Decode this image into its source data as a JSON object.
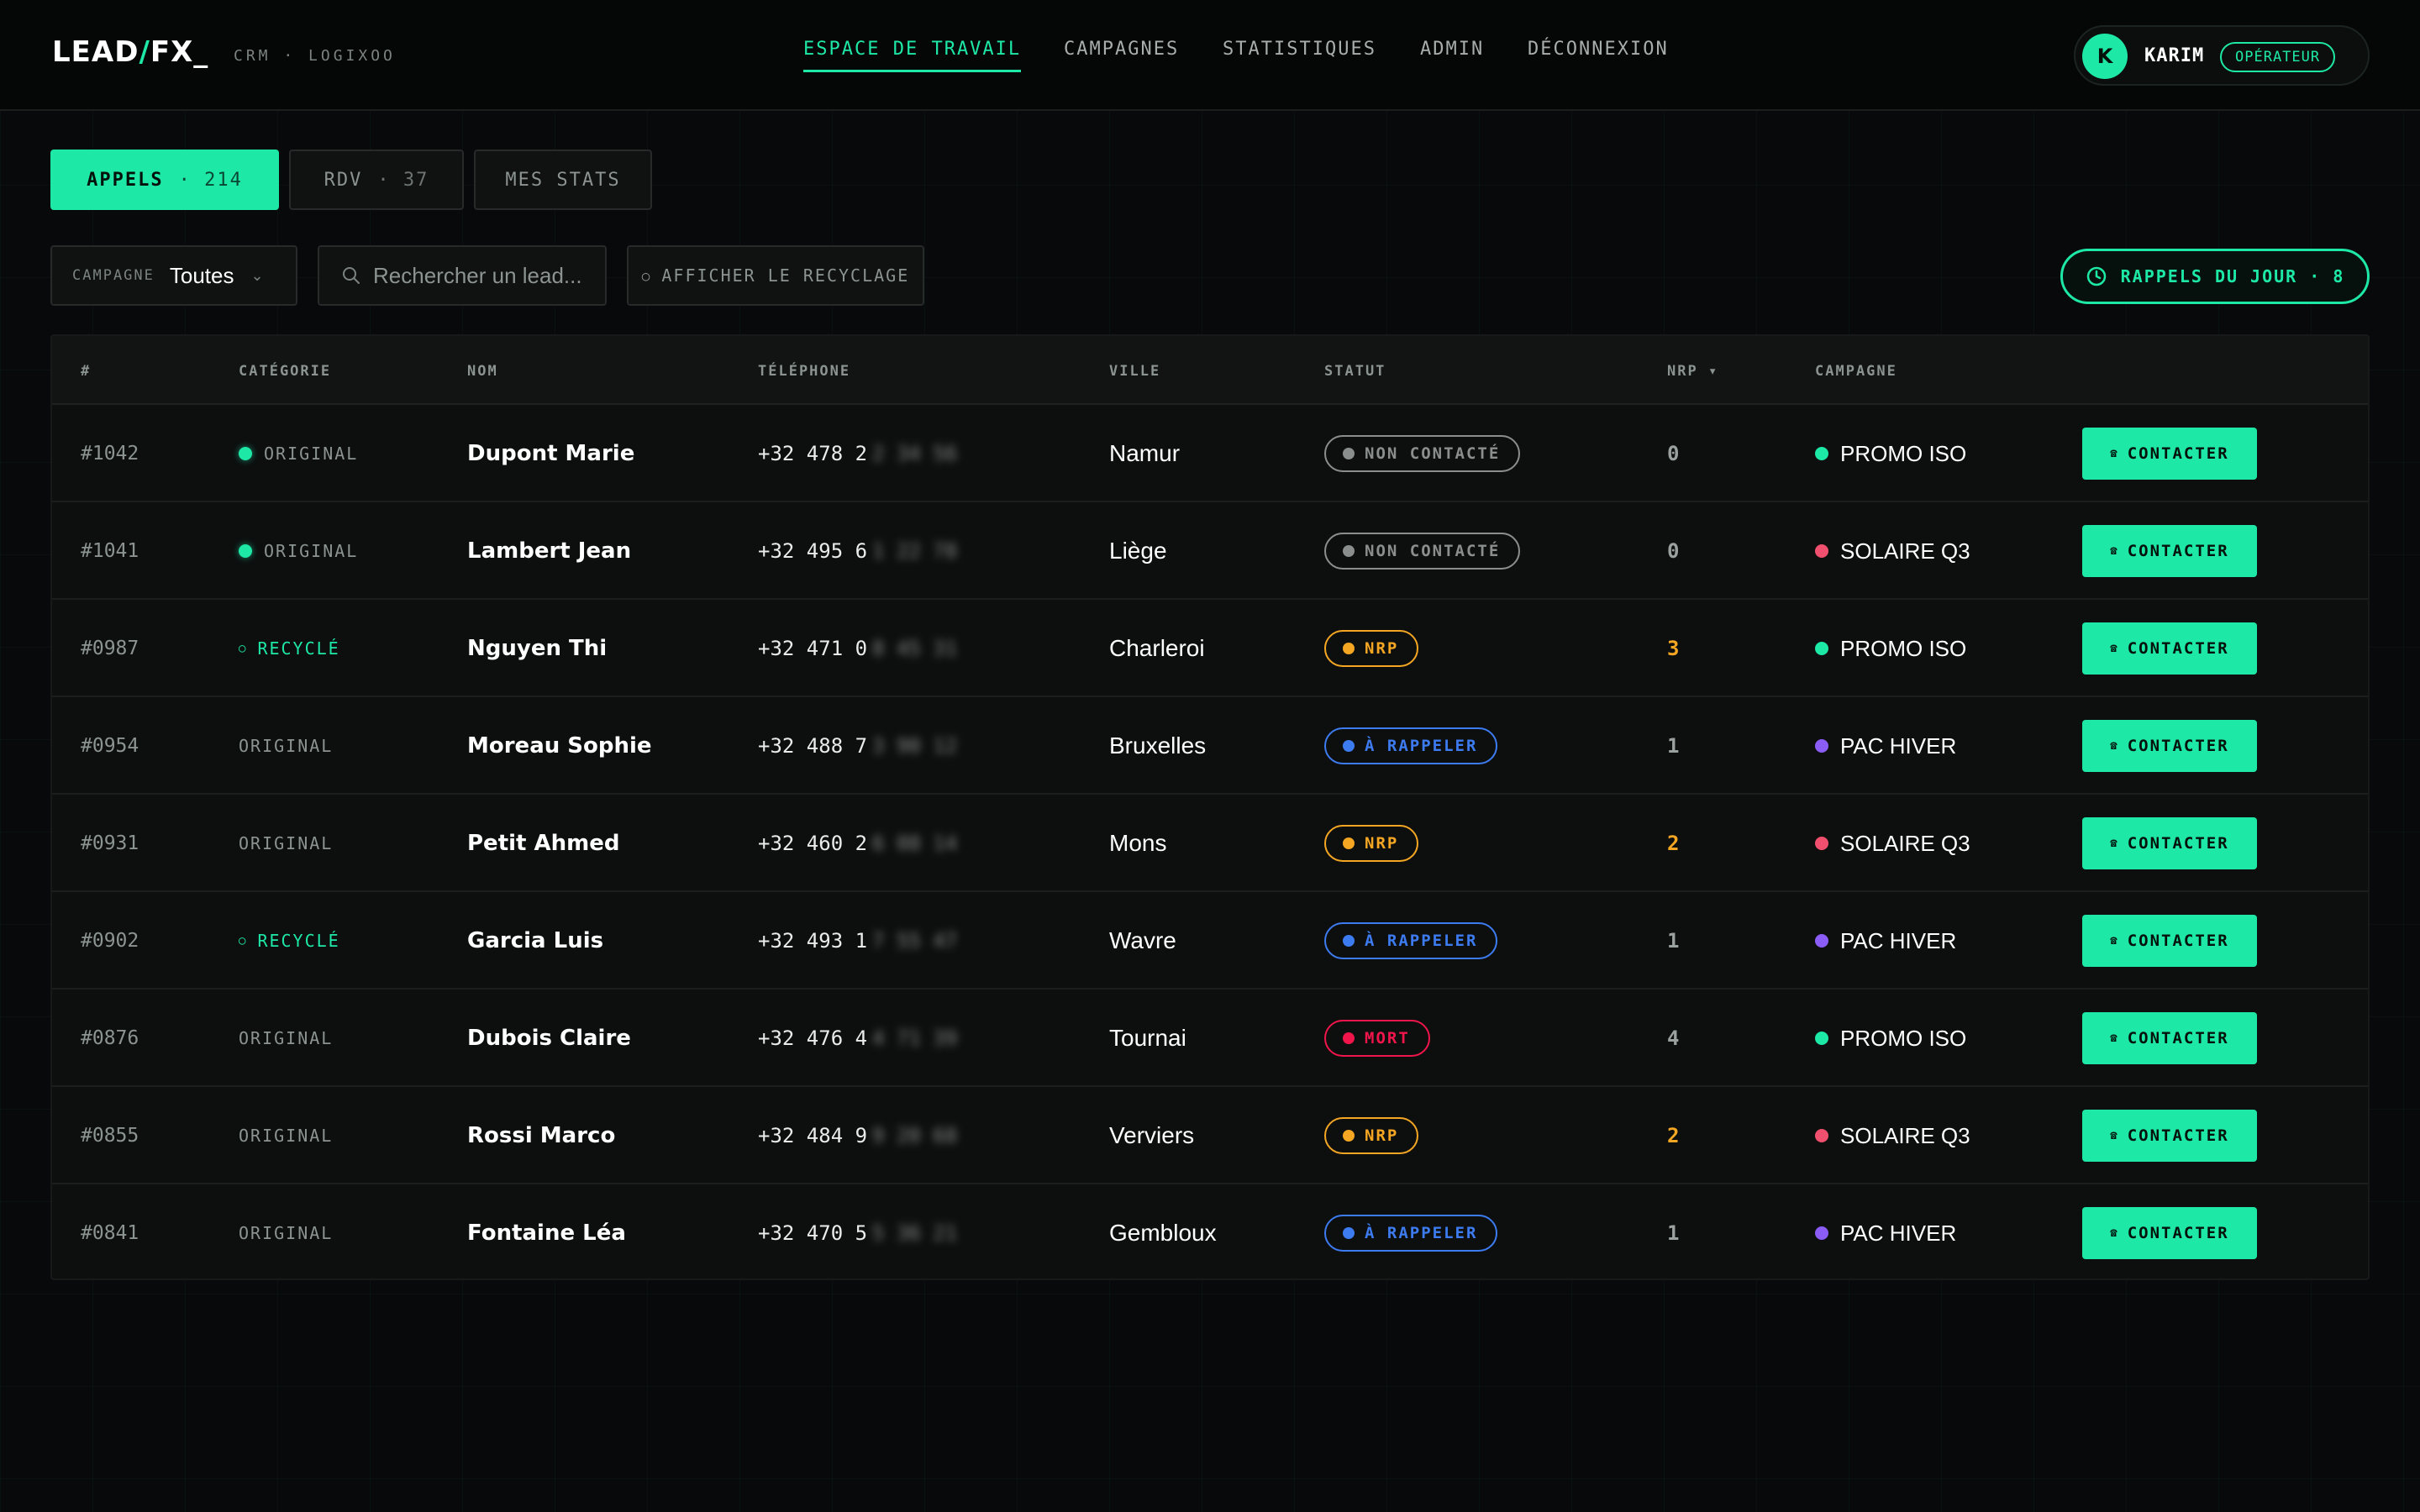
{
  "app": {
    "logo": {
      "part1": "LEAD",
      "slash": "/",
      "part2": "FX_"
    },
    "subtitle": "CRM · LOGIXOO"
  },
  "nav": {
    "items": [
      {
        "label": "ESPACE DE TRAVAIL",
        "active": true
      },
      {
        "label": "CAMPAGNES",
        "active": false
      },
      {
        "label": "STATISTIQUES",
        "active": false
      },
      {
        "label": "ADMIN",
        "active": false
      },
      {
        "label": "DÉCONNEXION",
        "active": false
      }
    ]
  },
  "user": {
    "initial": "K",
    "name": "KARIM",
    "role": "OPÉRATEUR"
  },
  "tabs": [
    {
      "label": "APPELS",
      "count": "· 214",
      "active": true
    },
    {
      "label": "RDV",
      "count": "· 37",
      "active": false
    },
    {
      "label": "MES STATS",
      "count": "",
      "active": false
    }
  ],
  "filters": {
    "campaign_label": "CAMPAGNE",
    "campaign_value": "Toutes",
    "search_placeholder": "Rechercher un lead...",
    "recycle_label": "AFFICHER LE RECYCLAGE",
    "recycle_icon": "recycle-icon",
    "reminders_label": "RAPPELS DU JOUR · 8",
    "reminders_icon": "clock-icon"
  },
  "table": {
    "headers": {
      "id": "#",
      "category": "CATÉGORIE",
      "name": "NOM",
      "phone": "TÉLÉPHONE",
      "city": "VILLE",
      "status": "STATUT",
      "nrp": "NRP ▾",
      "campaign": "CAMPAGNE"
    },
    "action_label": "CONTACTER",
    "action_icon": "phone-icon",
    "rows": [
      {
        "id": "#1042",
        "category": "ORIGINAL",
        "category_marker": "dot",
        "name": "Dupont Marie",
        "phone": "+32 478 2",
        "phone_masked": "2 34 56",
        "city": "Namur",
        "status": "NON CONTACTÉ",
        "status_type": "neutral",
        "nrp": "0",
        "nrp_level": "zero",
        "campaign": "PROMO ISO",
        "campaign_type": "green"
      },
      {
        "id": "#1041",
        "category": "ORIGINAL",
        "category_marker": "dot",
        "name": "Lambert Jean",
        "phone": "+32 495 6",
        "phone_masked": "1 22 78",
        "city": "Liège",
        "status": "NON CONTACTÉ",
        "status_type": "neutral",
        "nrp": "0",
        "nrp_level": "zero",
        "campaign": "SOLAIRE Q3",
        "campaign_type": "red"
      },
      {
        "id": "#0987",
        "category": "RECYCLÉ",
        "category_marker": "recycled",
        "name": "Nguyen Thi",
        "phone": "+32 471 0",
        "phone_masked": "8 45 31",
        "city": "Charleroi",
        "status": "NRP",
        "status_type": "nrp",
        "nrp": "3",
        "nrp_level": "warn",
        "campaign": "PROMO ISO",
        "campaign_type": "green"
      },
      {
        "id": "#0954",
        "category": "ORIGINAL",
        "category_marker": "none",
        "name": "Moreau Sophie",
        "phone": "+32 488 7",
        "phone_masked": "3 90 12",
        "city": "Bruxelles",
        "status": "À RAPPELER",
        "status_type": "callback",
        "nrp": "1",
        "nrp_level": "low",
        "campaign": "PAC HIVER",
        "campaign_type": "purple"
      },
      {
        "id": "#0931",
        "category": "ORIGINAL",
        "category_marker": "none",
        "name": "Petit Ahmed",
        "phone": "+32 460 2",
        "phone_masked": "6 08 14",
        "city": "Mons",
        "status": "NRP",
        "status_type": "nrp",
        "nrp": "2",
        "nrp_level": "warn",
        "campaign": "SOLAIRE Q3",
        "campaign_type": "red"
      },
      {
        "id": "#0902",
        "category": "RECYCLÉ",
        "category_marker": "recycled",
        "name": "Garcia Luis",
        "phone": "+32 493 1",
        "phone_masked": "7 55 47",
        "city": "Wavre",
        "status": "À RAPPELER",
        "status_type": "callback",
        "nrp": "1",
        "nrp_level": "low",
        "campaign": "PAC HIVER",
        "campaign_type": "purple"
      },
      {
        "id": "#0876",
        "category": "ORIGINAL",
        "category_marker": "none",
        "name": "Dubois Claire",
        "phone": "+32 476 4",
        "phone_masked": "4 71 39",
        "city": "Tournai",
        "status": "MORT",
        "status_type": "dead",
        "nrp": "4",
        "nrp_level": "low",
        "campaign": "PROMO ISO",
        "campaign_type": "green"
      },
      {
        "id": "#0855",
        "category": "ORIGINAL",
        "category_marker": "none",
        "name": "Rossi Marco",
        "phone": "+32 484 9",
        "phone_masked": "9 20 68",
        "city": "Verviers",
        "status": "NRP",
        "status_type": "nrp",
        "nrp": "2",
        "nrp_level": "warn",
        "campaign": "SOLAIRE Q3",
        "campaign_type": "red"
      },
      {
        "id": "#0841",
        "category": "ORIGINAL",
        "category_marker": "none",
        "name": "Fontaine Léa",
        "phone": "+32 470 5",
        "phone_masked": "5 36 21",
        "city": "Gembloux",
        "status": "À RAPPELER",
        "status_type": "callback",
        "nrp": "1",
        "nrp_level": "low",
        "campaign": "PAC HIVER",
        "campaign_type": "purple"
      }
    ]
  },
  "colors": {
    "accent": "#1ee8a6",
    "background": "#07090a",
    "status_neutral": "#8a8f8d",
    "status_nrp": "#f5a623",
    "status_callback": "#3d7bf0",
    "status_dead": "#f0154a",
    "campaign_green": "#1ee8a6",
    "campaign_red": "#f0506e",
    "campaign_purple": "#8b5cf6"
  }
}
